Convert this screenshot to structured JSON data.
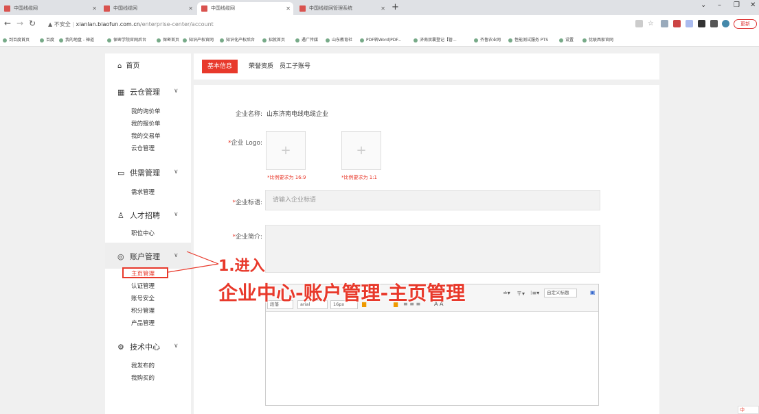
{
  "browser": {
    "tabs": [
      {
        "title": "中国线缆网"
      },
      {
        "title": "中国线缆网"
      },
      {
        "title": "中国线缆网"
      },
      {
        "title": "中国线缆网管理系统"
      }
    ],
    "new_tab_label": "+",
    "address": {
      "security_label": "▲ 不安全",
      "host": "xianlan.biaofun.com.cn",
      "path": "/enterprise-center/account"
    },
    "update_label": "更新",
    "bookmarks": [
      "到百度首页",
      "百度",
      "我的地盘 - 禅道",
      "保密学院官网后台",
      "保密首页",
      "知识产权官网",
      "知识化产权后台",
      "招就首页",
      "遇广传媒",
      "山东教育社",
      "PDF转Word|PDF...",
      "济南双囊登记【管...",
      "齐鲁农业网",
      "性能测试服务 PTS",
      "设置",
      "优联西家官网"
    ]
  },
  "sidebar": {
    "home": "首页",
    "sections": [
      {
        "title": "云仓管理",
        "icon": "grid-icon",
        "items": [
          "我的询价单",
          "我的报价单",
          "我的交易单",
          "云仓管理"
        ]
      },
      {
        "title": "供需管理",
        "icon": "calendar-icon",
        "items": [
          "需求管理"
        ]
      },
      {
        "title": "人才招聘",
        "icon": "person-icon",
        "items": [
          "职位中心"
        ]
      },
      {
        "title": "账户管理",
        "icon": "account-icon",
        "items": [
          "主页管理",
          "认证管理",
          "账号安全",
          "积分管理",
          "产品管理"
        ]
      },
      {
        "title": "技术中心",
        "icon": "gear-icon",
        "items": [
          "我发布的",
          "我购买的"
        ]
      }
    ]
  },
  "main": {
    "tabs": [
      "基本信息",
      "荣誉资质",
      "员工子账号"
    ],
    "form": {
      "company_name_label": "企业名称:",
      "company_name_value": "山东济南电线电缆企业",
      "logo_label": "企业 Logo:",
      "logo_hint_1": "*比例要求为 16:9",
      "logo_hint_2": "*比例要求为 1:1",
      "slogan_label": "企业标语:",
      "slogan_placeholder": "请输入企业标语",
      "intro_label": "企业简介:",
      "required_mark": "*"
    },
    "editor": {
      "block_select": "段落",
      "font_select": "arial",
      "size_select": "16px",
      "custom_title_select": "自定义标题"
    }
  },
  "annotation": {
    "step": "1.进入",
    "path": "企业中心-账户管理-主页管理"
  },
  "ime_label": "中"
}
